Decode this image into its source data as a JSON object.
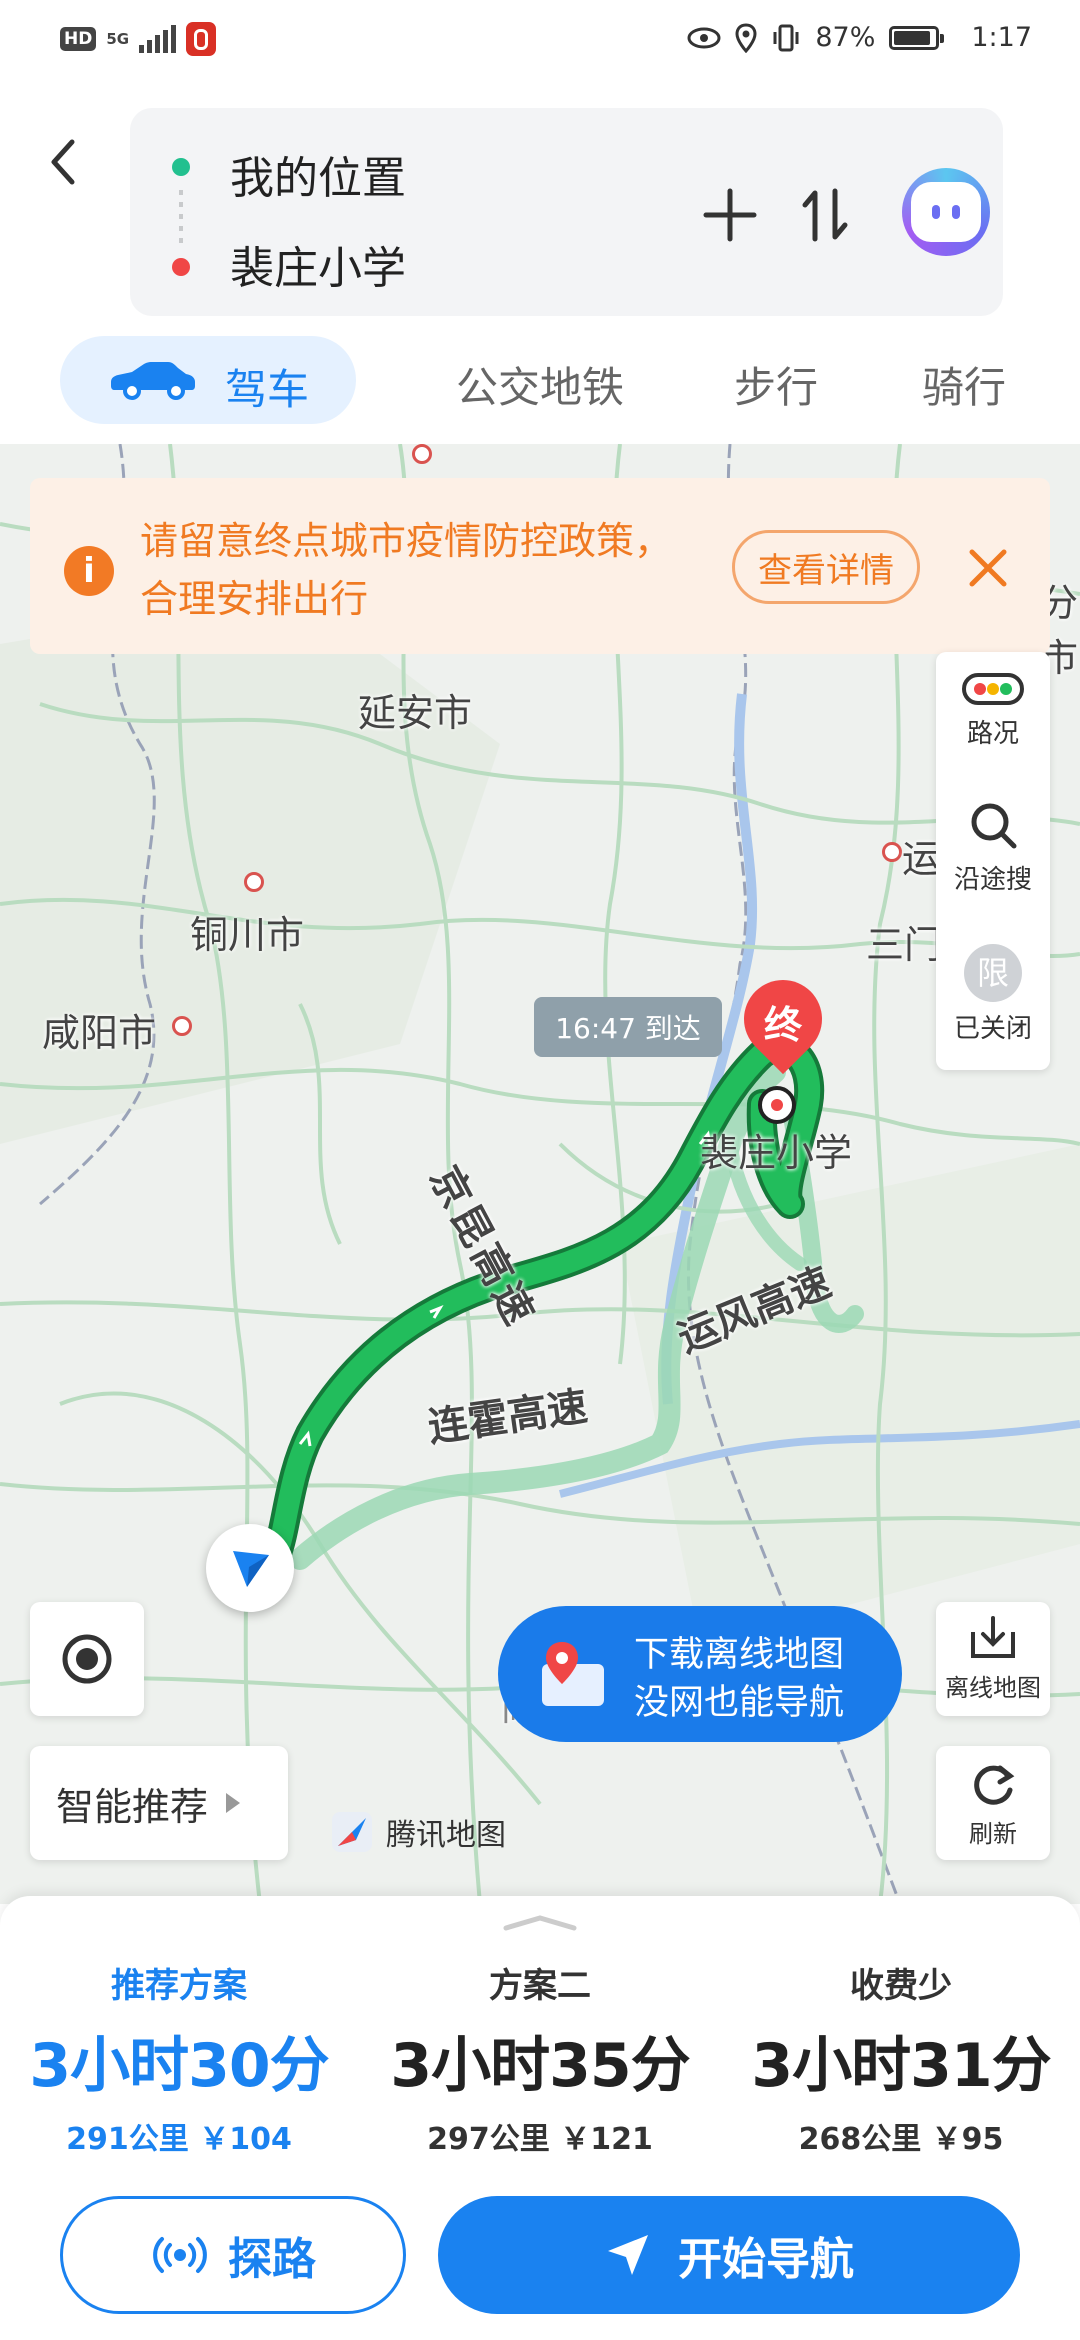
{
  "status_bar": {
    "hd": "HD",
    "network": "5G",
    "battery": "87%",
    "time": "1:17"
  },
  "route": {
    "origin": "我的位置",
    "destination": "裴庄小学"
  },
  "tabs": [
    {
      "label": "驾车",
      "active": true
    },
    {
      "label": "公交地铁",
      "active": false
    },
    {
      "label": "步行",
      "active": false
    },
    {
      "label": "骑行",
      "active": false
    }
  ],
  "notice": {
    "text": "请留意终点城市疫情防控政策，合理安排出行",
    "action": "查看详情",
    "icon": "info-icon"
  },
  "map_controls": {
    "traffic": "路况",
    "search_along": "沿途搜",
    "restriction_icon": "限",
    "restriction": "已关闭",
    "offline": "离线地图",
    "refresh": "刷新",
    "smart": "智能推荐",
    "brand": "腾讯地图"
  },
  "offline_promo": {
    "line1": "下载离线地图",
    "line2": "没网也能导航"
  },
  "map": {
    "cities": {
      "yanan": "延安市",
      "tongchuan": "铜川市",
      "xianyang": "咸阳市",
      "yuncheng": "运城市",
      "sanmenxia": "三门峡市",
      "partial_right": "分市",
      "partial_bottom": "商洛市"
    },
    "roads": {
      "jingkun": "京昆高速",
      "yunfeng": "运风高速",
      "lianhuo": "连霍高速"
    },
    "eta": "16:47 到达",
    "end_marker": "终",
    "destination_label": "裴庄小学"
  },
  "plans": [
    {
      "name": "推荐方案",
      "time": "3小时30分",
      "distance": "291公里",
      "cost": "￥104",
      "active": true
    },
    {
      "name": "方案二",
      "time": "3小时35分",
      "distance": "297公里",
      "cost": "￥121",
      "active": false
    },
    {
      "name": "收费少",
      "time": "3小时31分",
      "distance": "268公里",
      "cost": "￥95",
      "active": false
    }
  ],
  "actions": {
    "explore": "探路",
    "navigate": "开始导航"
  },
  "colors": {
    "primary": "#1a82f0",
    "route_green": "#1fb75a",
    "notice_orange": "#f07a22"
  }
}
